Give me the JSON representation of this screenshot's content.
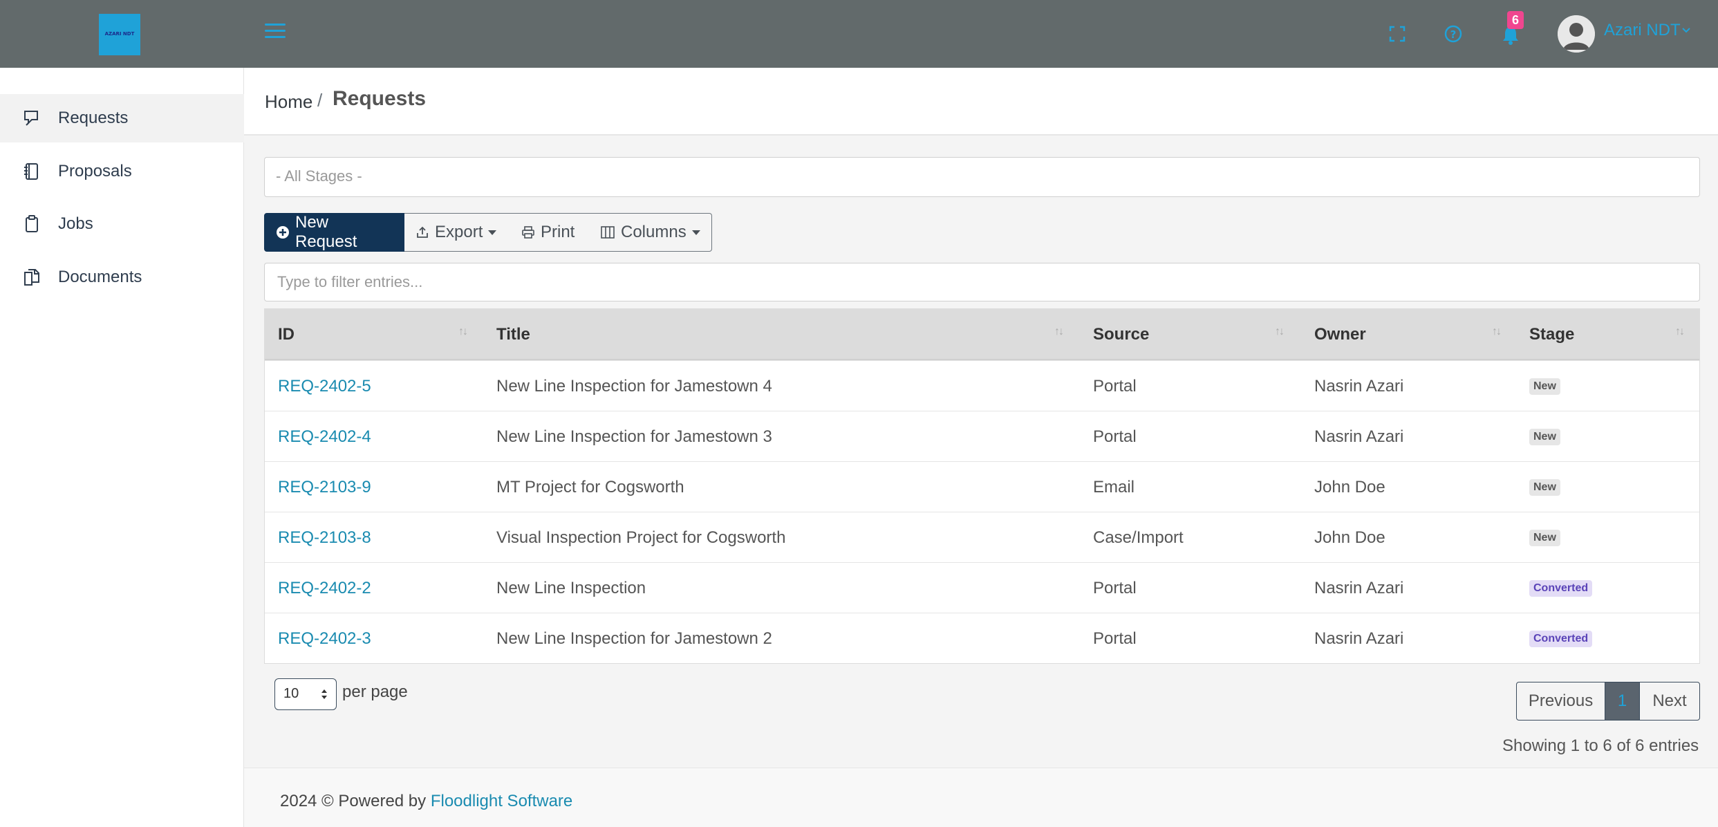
{
  "header": {
    "logo_text": "AZARI NDT",
    "notification_count": "6",
    "user_name": "Azari NDT"
  },
  "sidebar": {
    "items": [
      {
        "label": "Requests",
        "icon": "requests-icon",
        "active": true
      },
      {
        "label": "Proposals",
        "icon": "proposals-icon",
        "active": false
      },
      {
        "label": "Jobs",
        "icon": "jobs-icon",
        "active": false
      },
      {
        "label": "Documents",
        "icon": "documents-icon",
        "active": false
      }
    ]
  },
  "breadcrumb": {
    "home": "Home",
    "separator": "/",
    "current": "Requests"
  },
  "filters": {
    "stage_placeholder": "- All Stages -",
    "search_placeholder": "Type to filter entries..."
  },
  "toolbar": {
    "new_request": "New Request",
    "export": "Export",
    "print": "Print",
    "columns": "Columns"
  },
  "table": {
    "columns": [
      "ID",
      "Title",
      "Source",
      "Owner",
      "Stage"
    ],
    "rows": [
      {
        "id": "REQ-2402-5",
        "title": "New Line Inspection for Jamestown 4",
        "source": "Portal",
        "owner": "Nasrin Azari",
        "stage": "New"
      },
      {
        "id": "REQ-2402-4",
        "title": "New Line Inspection for Jamestown 3",
        "source": "Portal",
        "owner": "Nasrin Azari",
        "stage": "New"
      },
      {
        "id": "REQ-2103-9",
        "title": "MT Project for Cogsworth",
        "source": "Email",
        "owner": "John Doe",
        "stage": "New"
      },
      {
        "id": "REQ-2103-8",
        "title": "Visual Inspection Project for Cogsworth",
        "source": "Case/Import",
        "owner": "John Doe",
        "stage": "New"
      },
      {
        "id": "REQ-2402-2",
        "title": "New Line Inspection",
        "source": "Portal",
        "owner": "Nasrin Azari",
        "stage": "Converted"
      },
      {
        "id": "REQ-2402-3",
        "title": "New Line Inspection for Jamestown 2",
        "source": "Portal",
        "owner": "Nasrin Azari",
        "stage": "Converted"
      }
    ]
  },
  "pagination": {
    "per_page_value": "10",
    "per_page_label": "per page",
    "previous": "Previous",
    "current_page": "1",
    "next": "Next",
    "showing": "Showing 1 to 6 of 6 entries"
  },
  "footer": {
    "text": "2024 © Powered by",
    "link": "Floodlight Software"
  },
  "colors": {
    "topbar": "#626a6b",
    "accent": "#1fa2d8",
    "primary_button": "#123456",
    "link": "#1a8bb0",
    "badge_pink": "#f0468f",
    "badge_converted": "#e3dcf6"
  }
}
